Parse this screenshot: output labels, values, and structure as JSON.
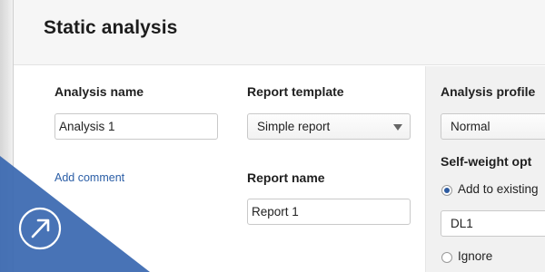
{
  "title": "Static analysis",
  "analysis_name": {
    "label": "Analysis name",
    "value": "Analysis 1",
    "add_comment": "Add comment"
  },
  "report_template": {
    "label": "Report template",
    "selected": "Simple report"
  },
  "report_name": {
    "label": "Report name",
    "value": "Report 1"
  },
  "analysis_profile": {
    "label": "Analysis profile",
    "selected": "Normal"
  },
  "self_weight": {
    "label": "Self-weight opt",
    "options": [
      {
        "label": "Add to existing",
        "checked": true
      },
      {
        "label": "Ignore",
        "checked": false
      }
    ],
    "load_case": "DL1"
  },
  "icons": {
    "launch": "arrow-up-right-circle-icon",
    "dropdown": "chevron-down-icon"
  },
  "colors": {
    "accent": "#2c5aa0",
    "link": "#2b5ea6",
    "badge": "#3a68b0"
  }
}
